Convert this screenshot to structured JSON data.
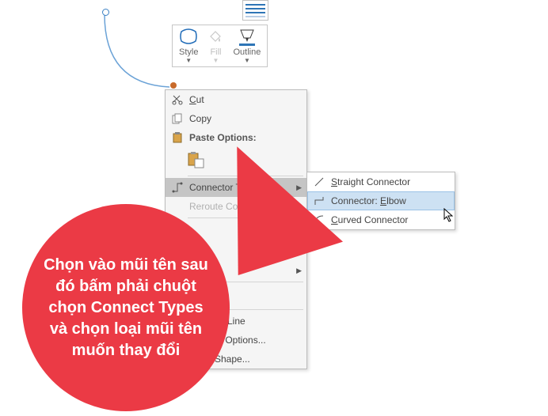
{
  "mini_toolbar": {
    "style_label": "Style",
    "fill_label": "Fill",
    "outline_label": "Outline"
  },
  "context_menu": {
    "cut": "Cut",
    "copy": "Copy",
    "paste_options_header": "Paste Options:",
    "connector_types": "Connector Types",
    "reroute_connectors": "Reroute Connectors",
    "default_line": "ult Line",
    "layout_options": "ut Options...",
    "format_shape": "Shape..."
  },
  "submenu": {
    "straight": "Straight Connector",
    "elbow": "Connector: Elbow",
    "curved": "Curved Connector"
  },
  "annotation": {
    "text": "Chọn vào mũi tên sau đó bấm phải chuột chọn Connect Types và chọn loại mũi tên muốn thay đổi"
  },
  "colors": {
    "accent_red": "#eb3a45",
    "arc_blue": "#6ca3d7",
    "handle_orange": "#c86a2a",
    "menu_hover_gray": "#c5c5c5",
    "submenu_hover_blue": "#cde1f3"
  }
}
